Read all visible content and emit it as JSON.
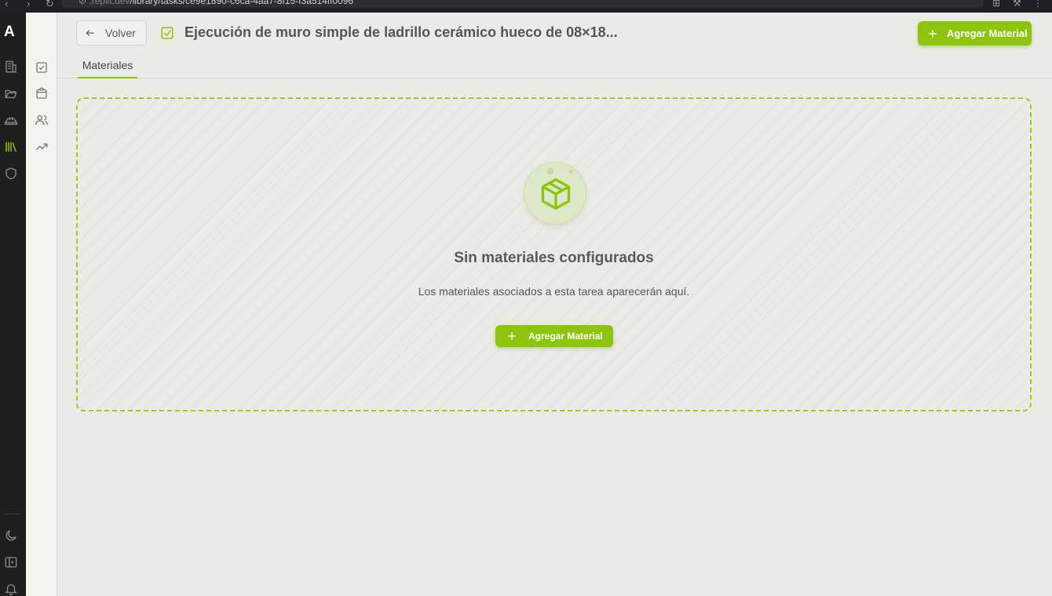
{
  "browser": {
    "url_dim": "⊘ .replit.dev",
    "url_path": "/library/tasks/ce9e1890-c6ca-4aa7-8f15-f3a514ff0096"
  },
  "rail": {
    "logo": "A"
  },
  "header": {
    "back_label": "Volver",
    "title": "Ejecución de muro simple de ladrillo cerámico hueco de 08×18...",
    "add_label": "Agregar Material"
  },
  "tabs": [
    {
      "label": "Materiales",
      "active": true
    }
  ],
  "empty_state": {
    "title": "Sin materiales configurados",
    "subtitle": "Los materiales asociados a esta tarea aparecerán aquí.",
    "button_label": "Agregar Material"
  },
  "colors": {
    "accent": "#8dc40e",
    "rail_bg": "#1e1f1f",
    "page_bg": "#ebebe6"
  }
}
